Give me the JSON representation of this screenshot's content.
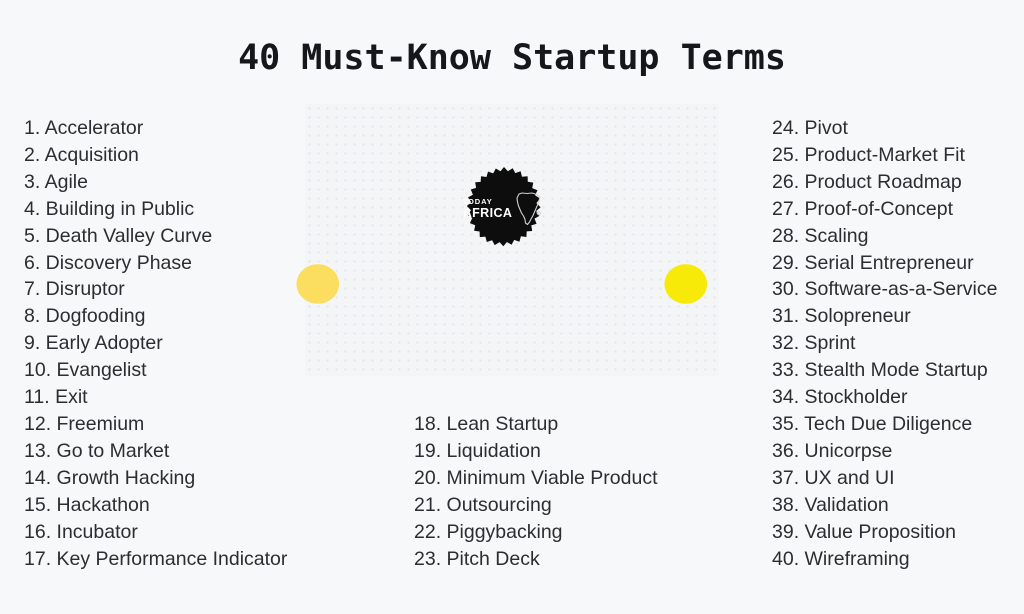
{
  "title": "40 Must-Know Startup Terms",
  "colors": {
    "background": "#f7f8f9",
    "panel": "#f4f5f7",
    "panel_dots": "#e2e5ea",
    "text": "#2c2d30",
    "title_text": "#15171a",
    "badge": "#0d0d0d",
    "circle_left": "#fbdd60",
    "circle_right": "#f7e908",
    "logo_text": "#ffffff"
  },
  "logo": {
    "line1": "TODAY",
    "line2": "AFRICA",
    "shape": "starburst-badge",
    "map": "africa-map-outline"
  },
  "columns": {
    "left": [
      "1. Accelerator",
      "2. Acquisition",
      "3. Agile",
      "4. Building in Public",
      "5. Death Valley Curve",
      "6. Discovery Phase",
      "7. Disruptor",
      "8. Dogfooding",
      "9. Early Adopter",
      "10. Evangelist",
      "11. Exit",
      "12. Freemium",
      "13. Go to Market",
      "14. Growth Hacking",
      "15. Hackathon",
      "16. Incubator",
      "17. Key Performance Indicator"
    ],
    "middle": [
      "18. Lean Startup",
      "19. Liquidation",
      "20. Minimum Viable Product",
      "21. Outsourcing",
      "22. Piggybacking",
      "23. Pitch Deck"
    ],
    "right": [
      "24. Pivot",
      "25. Product-Market Fit",
      "26. Product Roadmap",
      "27. Proof-of-Concept",
      "28. Scaling",
      "29. Serial Entrepreneur",
      "30. Software-as-a-Service",
      "31. Solopreneur",
      "32. Sprint",
      "33. Stealth Mode Startup",
      "34. Stockholder",
      "35. Tech Due Diligence",
      "36. Unicorpse",
      "37. UX and UI",
      "38. Validation",
      "39. Value Proposition",
      "40. Wireframing"
    ]
  }
}
